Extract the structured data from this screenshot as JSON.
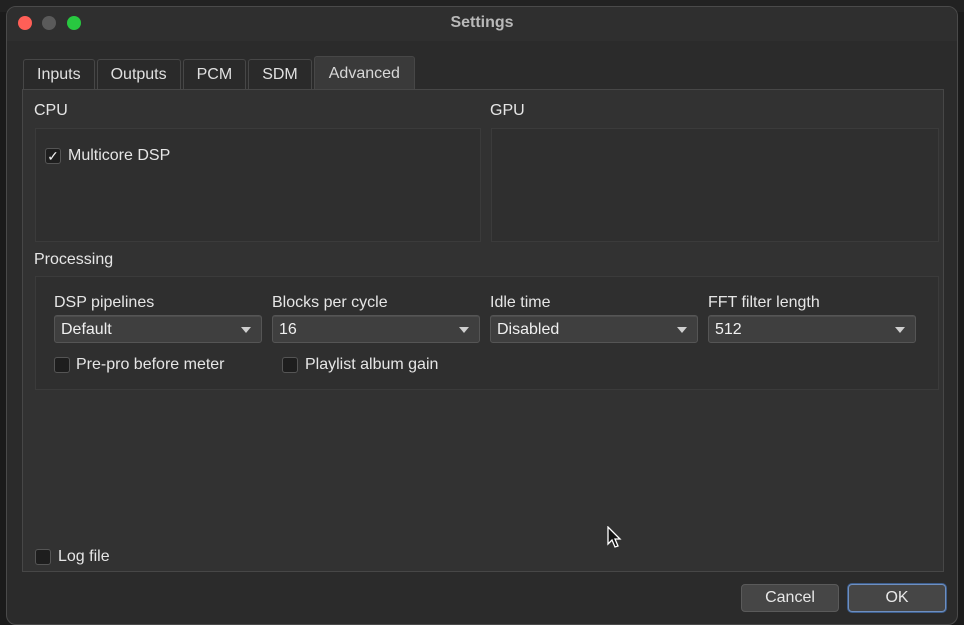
{
  "window": {
    "title": "Settings"
  },
  "tabs": [
    {
      "label": "Inputs"
    },
    {
      "label": "Outputs"
    },
    {
      "label": "PCM"
    },
    {
      "label": "SDM"
    },
    {
      "label": "Advanced",
      "active": true
    }
  ],
  "cpu": {
    "title": "CPU",
    "multicore": {
      "label": "Multicore DSP",
      "checked": true,
      "mark": "✓"
    }
  },
  "gpu": {
    "title": "GPU"
  },
  "processing": {
    "title": "Processing",
    "fields": [
      {
        "label": "DSP pipelines",
        "value": "Default"
      },
      {
        "label": "Blocks per cycle",
        "value": "16"
      },
      {
        "label": "Idle time",
        "value": "Disabled"
      },
      {
        "label": "FFT filter length",
        "value": "512"
      }
    ],
    "prepro": {
      "label": "Pre-pro before meter",
      "checked": false
    },
    "playlist_gain": {
      "label": "Playlist album gain",
      "checked": false
    }
  },
  "log_file": {
    "label": "Log file",
    "checked": false
  },
  "buttons": {
    "cancel": "Cancel",
    "ok": "OK"
  },
  "colors": {
    "close": "#ff5f57",
    "minimize": "#5a5a5a",
    "maximize": "#28c840"
  }
}
